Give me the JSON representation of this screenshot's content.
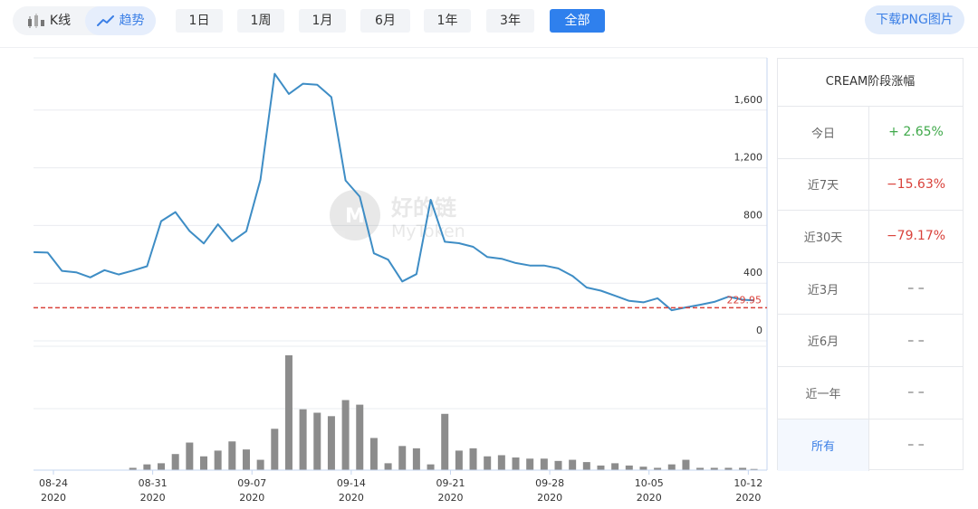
{
  "toolbar": {
    "kline_label": "K线",
    "trend_label": "趋势",
    "ranges": [
      "1日",
      "1周",
      "1月",
      "6月",
      "1年",
      "3年",
      "全部"
    ],
    "active_range": "全部",
    "download_label": "下载PNG图片"
  },
  "watermark": {
    "cn": "好的链",
    "en": "MyToken"
  },
  "panel": {
    "title": "CREAM阶段涨幅",
    "rows": [
      {
        "label": "今日",
        "value": "+ 2.65%",
        "trend": "up"
      },
      {
        "label": "近7天",
        "value": "−15.63%",
        "trend": "down"
      },
      {
        "label": "近30天",
        "value": "−79.17%",
        "trend": "down"
      },
      {
        "label": "近3月",
        "value": "– –",
        "trend": "none"
      },
      {
        "label": "近6月",
        "value": "– –",
        "trend": "none"
      },
      {
        "label": "近一年",
        "value": "– –",
        "trend": "none"
      },
      {
        "label": "所有",
        "value": "– –",
        "trend": "none",
        "selected": true
      }
    ]
  },
  "chart_data": [
    {
      "type": "line",
      "name": "price",
      "current_value": 229.95,
      "current_label": "229.95",
      "y_ticks": [
        "0",
        "400",
        "800",
        "1,200",
        "1,600"
      ],
      "y_tick_values": [
        0,
        400,
        800,
        1200,
        1600
      ],
      "ylim": [
        0,
        1900
      ],
      "grid": true,
      "color": "#3e8dc5",
      "marker_color": "#d9423b",
      "x_tick_labels": [
        {
          "date": "08-24",
          "year": "2020"
        },
        {
          "date": "08-31",
          "year": "2020"
        },
        {
          "date": "09-07",
          "year": "2020"
        },
        {
          "date": "09-14",
          "year": "2020"
        },
        {
          "date": "09-21",
          "year": "2020"
        },
        {
          "date": "09-28",
          "year": "2020"
        },
        {
          "date": "10-05",
          "year": "2020"
        },
        {
          "date": "10-12",
          "year": "2020"
        }
      ],
      "x_tick_days": [
        0,
        7,
        14,
        21,
        28,
        35,
        42,
        49
      ],
      "points": [
        [
          -1.4,
          615
        ],
        [
          -0.4,
          612
        ],
        [
          0.6,
          485
        ],
        [
          1.6,
          475
        ],
        [
          2.6,
          440
        ],
        [
          3.6,
          490
        ],
        [
          4.6,
          460
        ],
        [
          5.6,
          487
        ],
        [
          6.6,
          517
        ],
        [
          7.6,
          830
        ],
        [
          8.6,
          893
        ],
        [
          9.6,
          762
        ],
        [
          10.6,
          675
        ],
        [
          11.6,
          808
        ],
        [
          12.6,
          690
        ],
        [
          13.6,
          760
        ],
        [
          14.6,
          1117
        ],
        [
          15.6,
          1852
        ],
        [
          16.6,
          1712
        ],
        [
          17.6,
          1783
        ],
        [
          18.6,
          1776
        ],
        [
          19.6,
          1690
        ],
        [
          20.6,
          1112
        ],
        [
          21.6,
          1000
        ],
        [
          22.6,
          607
        ],
        [
          23.6,
          563
        ],
        [
          24.6,
          412
        ],
        [
          25.6,
          463
        ],
        [
          26.6,
          978
        ],
        [
          27.6,
          687
        ],
        [
          28.6,
          677
        ],
        [
          29.6,
          652
        ],
        [
          30.6,
          581
        ],
        [
          31.6,
          569
        ],
        [
          32.6,
          540
        ],
        [
          33.6,
          522
        ],
        [
          34.6,
          522
        ],
        [
          35.6,
          502
        ],
        [
          36.6,
          450
        ],
        [
          37.6,
          370
        ],
        [
          38.6,
          348
        ],
        [
          39.6,
          313
        ],
        [
          40.6,
          277
        ],
        [
          41.6,
          267
        ],
        [
          42.6,
          295
        ],
        [
          43.6,
          212
        ],
        [
          44.6,
          232
        ],
        [
          45.6,
          250
        ],
        [
          46.6,
          270
        ],
        [
          47.6,
          306
        ],
        [
          48.6,
          285
        ],
        [
          49.4,
          280
        ]
      ]
    },
    {
      "type": "bar",
      "name": "volume",
      "color": "#8c8c8c",
      "ylim": [
        0,
        1.0
      ],
      "x_days": [
        -0.4,
        0.6,
        1.6,
        2.6,
        3.6,
        4.6,
        5.6,
        6.6,
        7.6,
        8.6,
        9.6,
        10.6,
        11.6,
        12.6,
        13.6,
        14.6,
        15.6,
        16.6,
        17.6,
        18.6,
        19.6,
        20.6,
        21.6,
        22.6,
        23.6,
        24.6,
        25.6,
        26.6,
        27.6,
        28.6,
        29.6,
        30.6,
        31.6,
        32.6,
        33.6,
        34.6,
        35.6,
        36.6,
        37.6,
        38.6,
        39.6,
        40.6,
        41.6,
        42.6,
        43.6,
        44.6,
        45.6,
        46.6,
        47.6,
        48.6,
        49.4
      ],
      "values": [
        0.0,
        0.0,
        0.0,
        0.0,
        0.0,
        0.0,
        0.02,
        0.05,
        0.06,
        0.14,
        0.24,
        0.12,
        0.17,
        0.25,
        0.18,
        0.09,
        0.36,
        1.0,
        0.53,
        0.5,
        0.47,
        0.61,
        0.57,
        0.28,
        0.06,
        0.21,
        0.19,
        0.05,
        0.49,
        0.17,
        0.19,
        0.12,
        0.13,
        0.11,
        0.1,
        0.1,
        0.08,
        0.09,
        0.07,
        0.04,
        0.06,
        0.04,
        0.03,
        0.02,
        0.05,
        0.09,
        0.02,
        0.02,
        0.02,
        0.02,
        0.01
      ]
    }
  ]
}
